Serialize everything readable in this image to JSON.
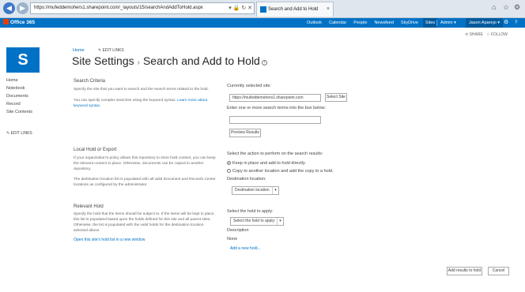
{
  "browser": {
    "address": "https://mufeddemohers1.sharepoint.com/_layouts/15/searchAndAddToHold.aspx",
    "tab_title": "Search and Add to Hold",
    "back_glyph": "◀",
    "forward_glyph": "▶",
    "address_controls": "▾ 🔒 ↻ ✕",
    "tab_close": "×",
    "home_glyph": "⌂",
    "star_glyph": "☆",
    "settings_glyph": "⚙"
  },
  "suitebar": {
    "brand": "Office 365",
    "links": [
      "Outlook",
      "Calendar",
      "People",
      "Newsfeed",
      "SkyDrive",
      "Sites"
    ],
    "active_link": "Sites",
    "admin": "Admin ▾",
    "user": "Jason Aparejo ▾",
    "gear_glyph": "⚙",
    "help_glyph": "?"
  },
  "actions": {
    "share": "SHARE",
    "follow": "FOLLOW"
  },
  "breadcrumb": {
    "home": "Home",
    "edit_links": "EDIT LINKS"
  },
  "page": {
    "title": "Site Settings",
    "separator": "›",
    "subtitle": "Search and Add to Hold",
    "info_glyph": "i"
  },
  "leftnav": {
    "items": [
      "Home",
      "Notebook",
      "Documents",
      "Record",
      "Site Contents"
    ],
    "edit_links": "EDIT LINKS"
  },
  "search_criteria": {
    "title": "Search Criteria",
    "desc1": "Specify the site that you want to search and the search terms related to the hold.",
    "desc2": "You can specify complex searches using the keyword syntax.",
    "link": "Learn more about keyword syntax.",
    "site_label": "Currently selected site:",
    "site_value": "https://mufeddemohers1.sharepoint.com",
    "select_button": "Select Site",
    "terms_label": "Enter one or more search terms into the box below:",
    "terms_value": "",
    "preview_button": "Preview Results"
  },
  "local_hold": {
    "title": "Local Hold or Export",
    "desc1": "If your organization's policy allows this repository to store hold content, you can keep the relevant content in place. Otherwise, documents can be copied to another repository.",
    "desc2": "The destination location list is populated with all valid Document and Records Center locations as configured by the administrator.",
    "action_label": "Select the action to perform on the search results:",
    "option1": "Keep in place and add to hold directly.",
    "option2": "Copy to another location and add the copy to a hold.",
    "destination_label": "Destination location:",
    "destination_value": "Destination location"
  },
  "relevant_hold": {
    "title": "Relevant Hold",
    "desc": "Specify the hold that the items should be subject to. If the items will be kept in place, this list is populated based upon the holds defined for this site and all parent sites. Otherwise, the list is populated with the valid holds for the destination location selected above.",
    "link": "Open this site's hold list in a new window",
    "hold_label": "Select the hold to apply:",
    "hold_value": "Select the hold to apply:",
    "description_label": "Description",
    "description_value": "None",
    "add_link": "Add a new hold..."
  },
  "footer": {
    "add_button": "Add results to hold",
    "cancel_button": "Cancel"
  }
}
